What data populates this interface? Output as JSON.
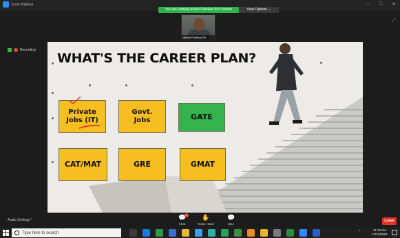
{
  "window": {
    "title": "Zoom Webinar",
    "share_banner": "You are viewing Akash Pushkar Sir's screen",
    "view_options": "View Options ⌄"
  },
  "video": {
    "name": "Akash Pushkar Sir"
  },
  "recording": {
    "label": "Recording"
  },
  "slide": {
    "title": "WHAT'S THE CAREER PLAN?",
    "boxes": [
      {
        "line1": "Private",
        "line2": "Jobs (IT)",
        "color": "#f7be22"
      },
      {
        "line1": "Govt.",
        "line2": "Jobs",
        "color": "#f7be22"
      },
      {
        "line1": "GATE",
        "line2": "",
        "color": "#34b24c"
      },
      {
        "line1": "CAT/MAT",
        "line2": "",
        "color": "#f7be22"
      },
      {
        "line1": "GRE",
        "line2": "",
        "color": "#f7be22"
      },
      {
        "line1": "GMAT",
        "line2": "",
        "color": "#f7be22"
      }
    ]
  },
  "toolbar": {
    "audio_settings": "Audio Settings ^",
    "chat": "Chat",
    "chat_badge": "1",
    "raise_hand": "Raise Hand",
    "qa": "Q&A",
    "leave": "Leave"
  },
  "taskbar": {
    "search_placeholder": "Type here to search",
    "time": "11:10 AM",
    "date": "12/10/2020"
  },
  "icons": {
    "chat": "chat-icon",
    "raise_hand": "raise-hand-icon",
    "qa": "qa-icon"
  }
}
